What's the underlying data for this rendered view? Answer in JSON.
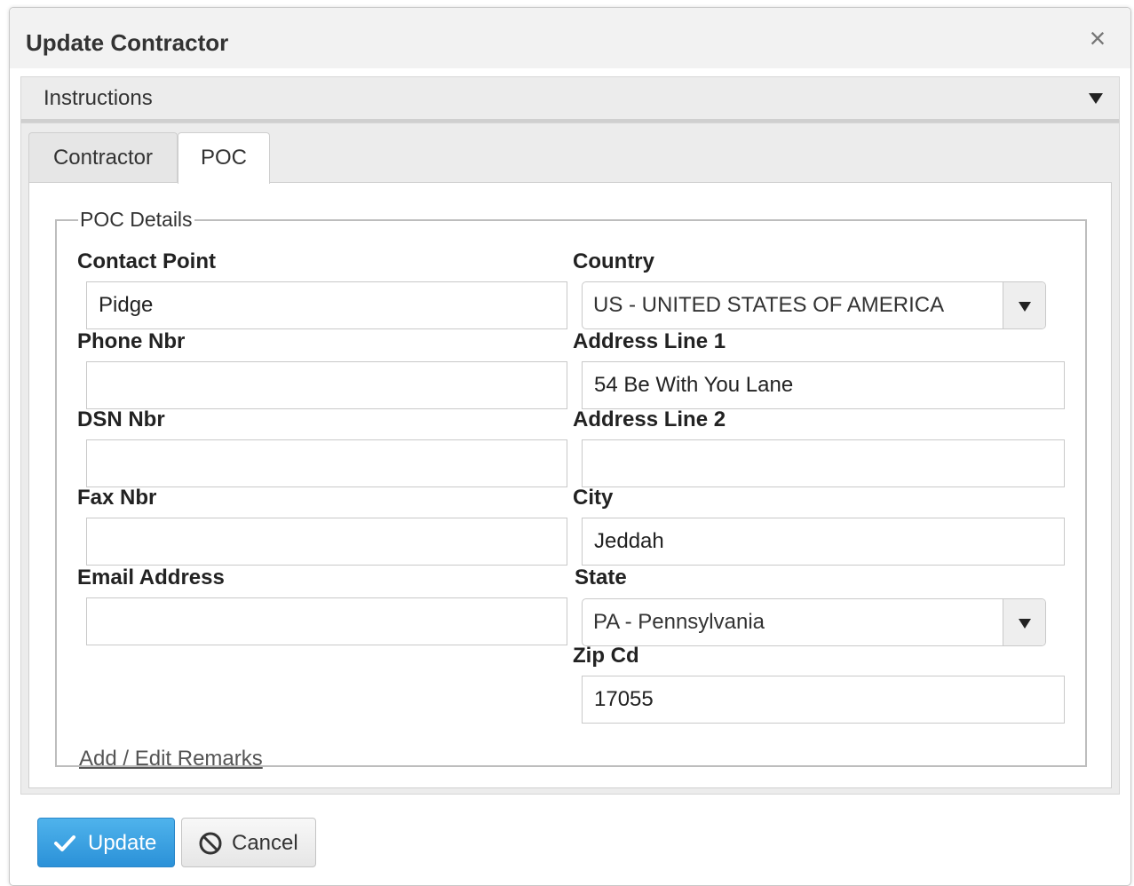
{
  "dialog": {
    "title": "Update Contractor",
    "close_glyph": "×"
  },
  "instructions": {
    "label": "Instructions"
  },
  "tabs": [
    {
      "label": "Contractor",
      "active": false
    },
    {
      "label": "POC",
      "active": true
    }
  ],
  "poc": {
    "legend": "POC Details",
    "contact_point": {
      "label": "Contact Point",
      "value": "Pidge"
    },
    "phone_nbr": {
      "label": "Phone Nbr",
      "value": ""
    },
    "dsn_nbr": {
      "label": "DSN Nbr",
      "value": ""
    },
    "fax_nbr": {
      "label": "Fax Nbr",
      "value": ""
    },
    "email_address": {
      "label": "Email Address",
      "value": ""
    },
    "country": {
      "label": "Country",
      "value": "US - UNITED STATES OF AMERICA"
    },
    "address_line_1": {
      "label": "Address Line 1",
      "value": "54 Be With You Lane"
    },
    "address_line_2": {
      "label": "Address Line 2",
      "value": ""
    },
    "city": {
      "label": "City",
      "value": "Jeddah"
    },
    "state": {
      "label": "State",
      "value": "PA - Pennsylvania"
    },
    "zip_cd": {
      "label": "Zip Cd",
      "value": "17055"
    },
    "remarks_link": "Add / Edit Remarks"
  },
  "buttons": {
    "update": "Update",
    "cancel": "Cancel"
  },
  "icons": {
    "close": "close-icon",
    "instructions_toggle": "caret-down-icon",
    "select_arrow": "caret-down-icon",
    "update": "checkmark-icon",
    "cancel": "ban-icon"
  },
  "colors": {
    "primary_button": "#2b91d8",
    "title_bar": "#f2f2f2"
  }
}
